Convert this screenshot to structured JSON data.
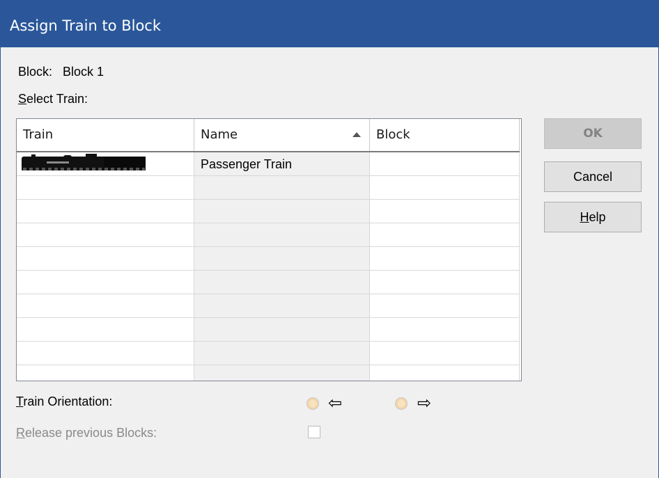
{
  "window": {
    "title": "Assign Train to Block"
  },
  "block": {
    "label": "Block:",
    "value": "Block 1"
  },
  "select_train": {
    "mnemonic": "S",
    "rest": "elect Train:"
  },
  "table": {
    "columns": [
      {
        "label": "Train"
      },
      {
        "label": "Name",
        "sorted": "ascending"
      },
      {
        "label": "Block"
      }
    ],
    "rows": [
      {
        "train_icon": "locomotive-thumbnail",
        "name": "Passenger Train",
        "block": ""
      }
    ]
  },
  "buttons": {
    "ok": "OK",
    "cancel": "Cancel",
    "help_mnemonic": "H",
    "help_rest": "elp"
  },
  "orientation": {
    "mnemonic": "T",
    "rest": "rain Orientation:",
    "left_arrow": "⇦",
    "right_arrow": "⇨"
  },
  "release": {
    "mnemonic": "R",
    "rest": "elease previous Blocks:"
  },
  "colors": {
    "title_bar": "#2b579a",
    "dialog_bg": "#f0f0f0",
    "radio_fill": "#f3d2a2"
  }
}
